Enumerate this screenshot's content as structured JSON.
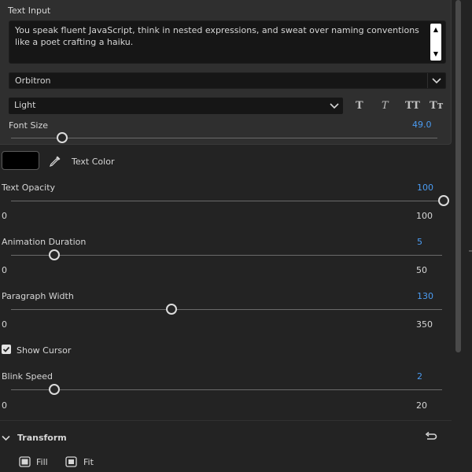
{
  "text_input": {
    "label": "Text Input",
    "value_line1": "You speak fluent JavaScript, think in nested expressions, and sweat over naming conventions",
    "value_line2": "like a poet crafting a haiku."
  },
  "font": {
    "family": "Orbitron",
    "weight": "Light",
    "style_buttons": [
      "T",
      "T",
      "TT",
      "Tт"
    ]
  },
  "font_size": {
    "label": "Font Size",
    "value": "49.0",
    "level": 0.12
  },
  "text_color": {
    "label": "Text Color",
    "color": "#000000"
  },
  "text_opacity": {
    "label": "Text Opacity",
    "value": "100",
    "min": "0",
    "max": "100",
    "level": 1.0
  },
  "animation_duration": {
    "label": "Animation Duration",
    "value": "5",
    "min": "0",
    "max": "50",
    "level": 0.1
  },
  "paragraph_width": {
    "label": "Paragraph Width",
    "value": "130",
    "min": "0",
    "max": "350",
    "level": 0.3714
  },
  "show_cursor": {
    "label": "Show Cursor",
    "checked": true
  },
  "blink_speed": {
    "label": "Blink Speed",
    "value": "2",
    "min": "0",
    "max": "20",
    "level": 0.1
  },
  "transform": {
    "title": "Transform",
    "fill_label": "Fill",
    "fit_label": "Fit"
  },
  "colors": {
    "accent": "#4b9cf2",
    "panel": "#232323",
    "group": "#2f2f2f",
    "field": "#161616"
  }
}
